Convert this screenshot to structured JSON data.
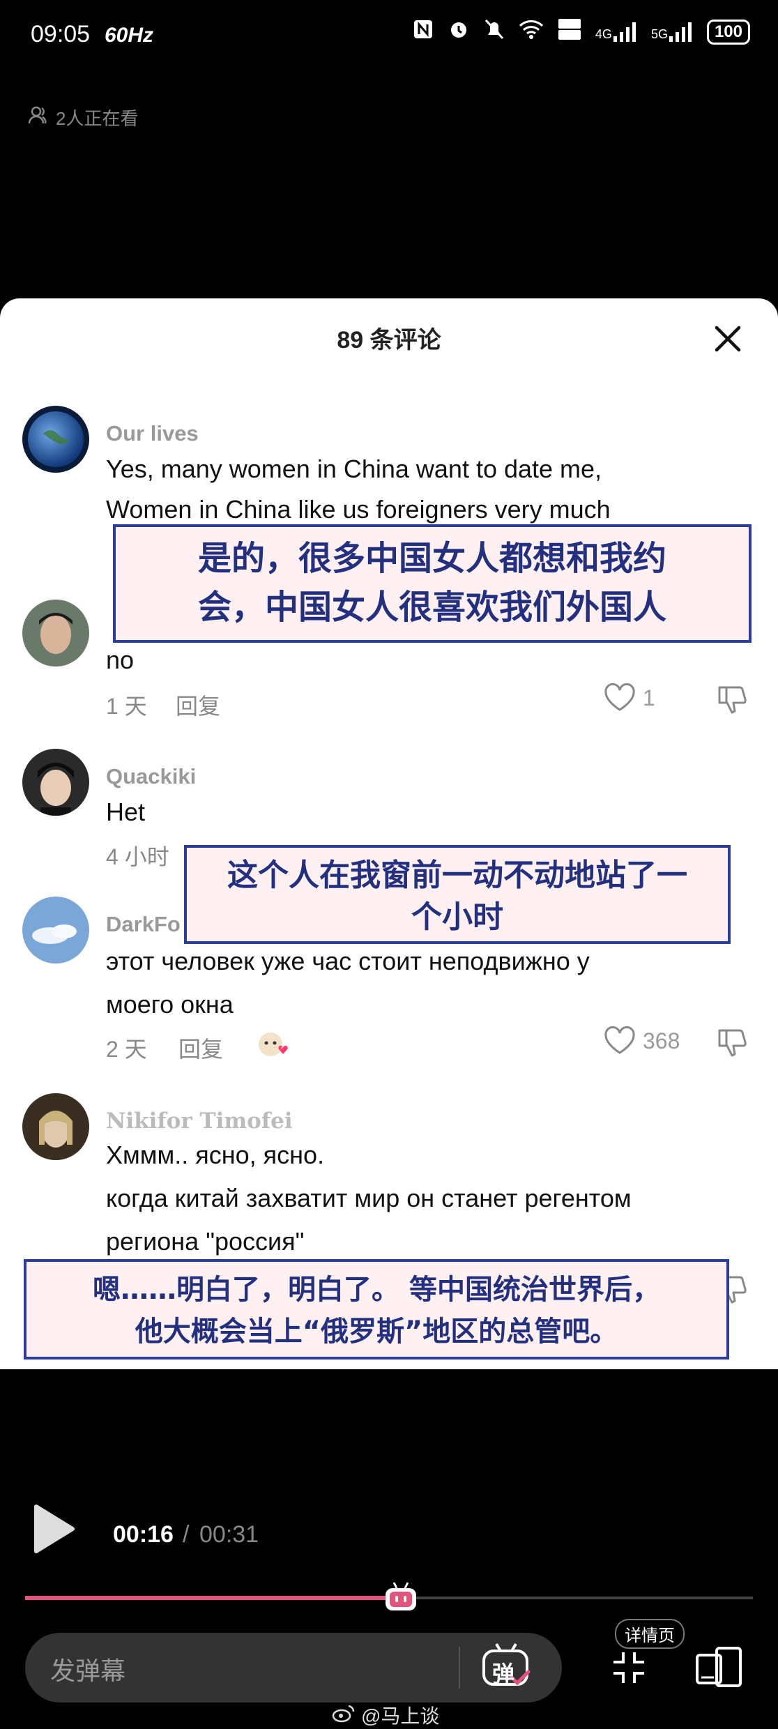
{
  "status_bar": {
    "time": "09:05",
    "refresh_rate": "60Hz",
    "network_1": "4G",
    "network_2": "5G",
    "battery": "100"
  },
  "viewers": "2人正在看",
  "comments_panel": {
    "title": "89 条评论",
    "comments": [
      {
        "name": "Our lives",
        "text_1": "Yes, many women in China want to date me,",
        "text_2": "Women in China like us foreigners very much"
      },
      {
        "text": "no",
        "time": "1 天",
        "reply": "回复",
        "likes": "1"
      },
      {
        "name": "Quackiki",
        "text": "Het",
        "time": "4 小时"
      },
      {
        "name": "DarkFo",
        "text_1": "этот человек уже час стоит неподвижно у",
        "text_2": "моего окна",
        "time": "2 天",
        "reply": "回复",
        "likes": "368"
      },
      {
        "name": "Nikifor Timofei",
        "text_1": "Хммм.. ясно, ясно.",
        "text_2": "когда китай захватит мир он станет регентом",
        "text_3": "региона \"россия\""
      }
    ]
  },
  "overlays": {
    "o1_line1": "是的，很多中国女人都想和我约",
    "o1_line2": "会，中国女人很喜欢我们外国人",
    "o2_line1": "这个人在我窗前一动不动地站了一",
    "o2_line2": "个小时",
    "o3_line1": "嗯……明白了，明白了。 等中国统治世界后，",
    "o3_line2": "他大概会当上“俄罗斯”地区的总管吧。"
  },
  "player": {
    "current_time": "00:16",
    "separator": "/",
    "total_time": "00:31",
    "progress_fraction": 0.516,
    "danmaku_placeholder": "发弹幕",
    "danmaku_toggle_label": "弹",
    "detail_label": "详情页"
  },
  "watermark": "@马上谈",
  "colors": {
    "overlay_border": "#2b3d9a",
    "overlay_bg": "#fff0f2",
    "progress": "#e2547c"
  }
}
